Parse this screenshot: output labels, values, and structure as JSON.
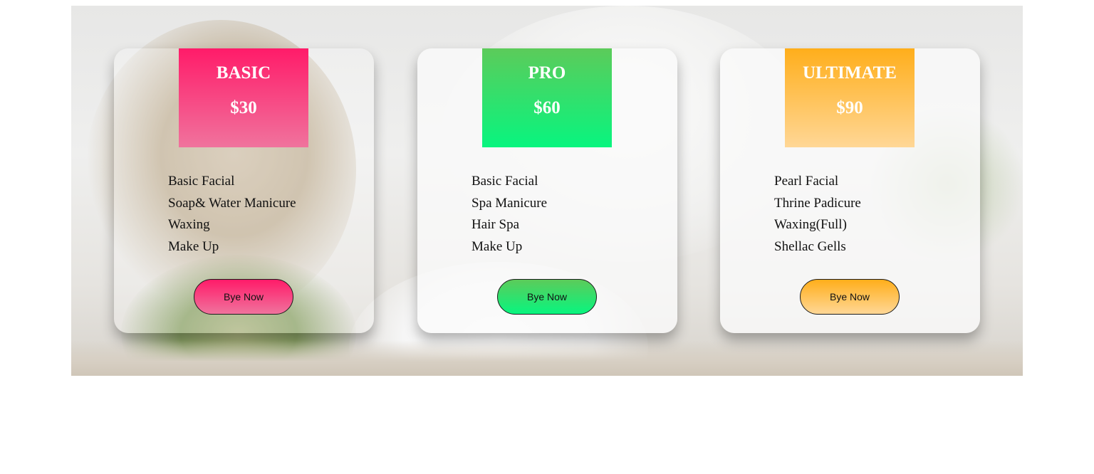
{
  "colors": {
    "basic": [
      "#ff1b69",
      "#f0739d"
    ],
    "pro": [
      "#5ccb5a",
      "#08f57f"
    ],
    "ultimate": [
      "#ffae1b",
      "#ffd796"
    ]
  },
  "plans": [
    {
      "name": "BASIC",
      "price": "$30",
      "features": [
        "Basic Facial",
        "Soap& Water Manicure",
        "Waxing",
        "Make Up"
      ],
      "button": "Bye Now"
    },
    {
      "name": "PRO",
      "price": "$60",
      "features": [
        "Basic Facial",
        "Spa Manicure",
        "Hair Spa",
        "Make Up"
      ],
      "button": "Bye Now"
    },
    {
      "name": "ULTIMATE",
      "price": "$90",
      "features": [
        "Pearl Facial",
        "Thrine Padicure",
        "Waxing(Full)",
        "Shellac Gells"
      ],
      "button": "Bye Now"
    }
  ]
}
